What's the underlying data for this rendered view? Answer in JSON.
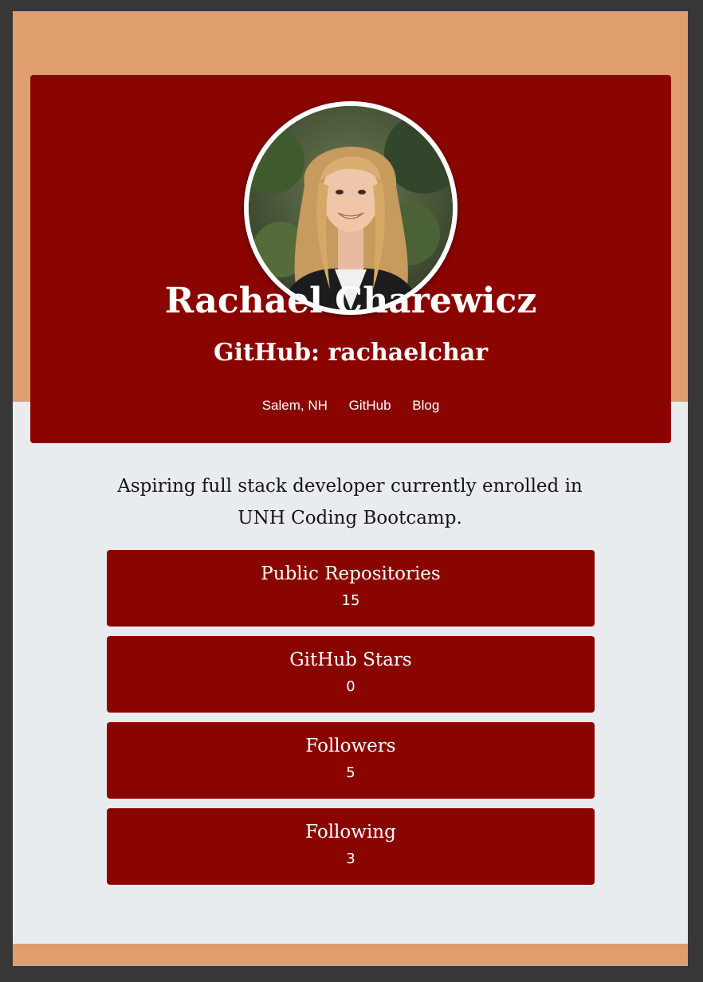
{
  "profile": {
    "name": "Rachael Charewicz",
    "github_handle": "GitHub: rachaelchar",
    "avatar_icon": "profile-photo",
    "links": [
      {
        "label": "Salem, NH"
      },
      {
        "label": "GitHub"
      },
      {
        "label": "Blog"
      }
    ],
    "bio": "Aspiring full stack developer currently enrolled in UNH Coding Bootcamp."
  },
  "stats": [
    {
      "label": "Public Repositories",
      "value": "15"
    },
    {
      "label": "GitHub Stars",
      "value": "0"
    },
    {
      "label": "Followers",
      "value": "5"
    },
    {
      "label": "Following",
      "value": "3"
    }
  ],
  "colors": {
    "background": "#e9ecee",
    "accent_band": "#e09d6e",
    "card": "#8b0500",
    "frame": "#373738"
  }
}
